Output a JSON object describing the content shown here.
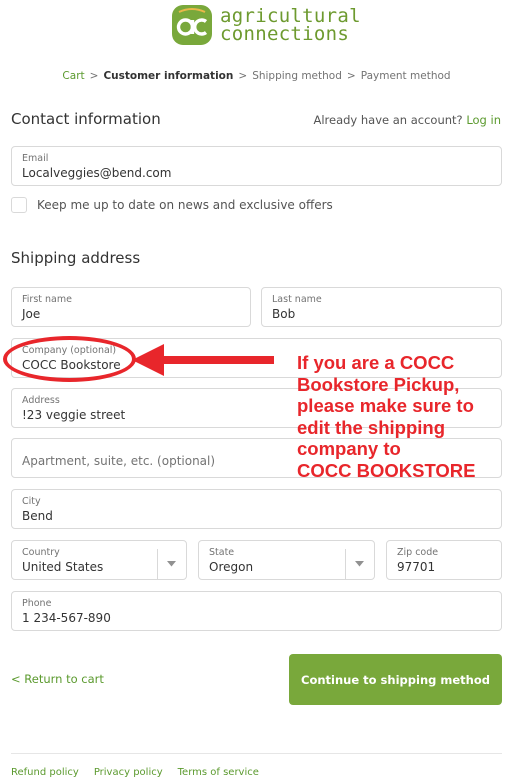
{
  "brand": {
    "logo_mark_text": "ac",
    "name_line1": "agricultural",
    "name_line2": "connections",
    "primary_color": "#79a83b",
    "link_color": "#5b9a2e"
  },
  "breadcrumb": {
    "items": [
      "Cart",
      "Customer information",
      "Shipping method",
      "Payment method"
    ],
    "separator": ">"
  },
  "contact": {
    "title": "Contact information",
    "account_prompt": "Already have an account?",
    "login_label": "Log in",
    "email_label": "Email",
    "email_value": "Localveggies@bend.com",
    "newsletter_label": "Keep me up to date on news and exclusive offers",
    "newsletter_checked": false
  },
  "shipping": {
    "title": "Shipping address",
    "first_name_label": "First name",
    "first_name_value": "Joe",
    "last_name_label": "Last name",
    "last_name_value": "Bob",
    "company_label": "Company (optional)",
    "company_value": "COCC Bookstore",
    "address_label": "Address",
    "address_value": "!23 veggie street",
    "apartment_placeholder": "Apartment, suite, etc. (optional)",
    "city_label": "City",
    "city_value": "Bend",
    "country_label": "Country",
    "country_value": "United States",
    "state_label": "State",
    "state_value": "Oregon",
    "zip_label": "Zip code",
    "zip_value": "97701",
    "phone_label": "Phone",
    "phone_value": "1 234-567-890"
  },
  "annotation": {
    "color": "#e8262b",
    "lines": [
      "If you are a COCC",
      "Bookstore Pickup,",
      "please make sure to",
      "edit the shipping",
      "company to",
      "COCC BOOKSTORE"
    ]
  },
  "actions": {
    "return_label": "< Return to cart",
    "continue_label": "Continue to shipping method"
  },
  "footer": {
    "links": [
      "Refund policy",
      "Privacy policy",
      "Terms of service"
    ]
  }
}
